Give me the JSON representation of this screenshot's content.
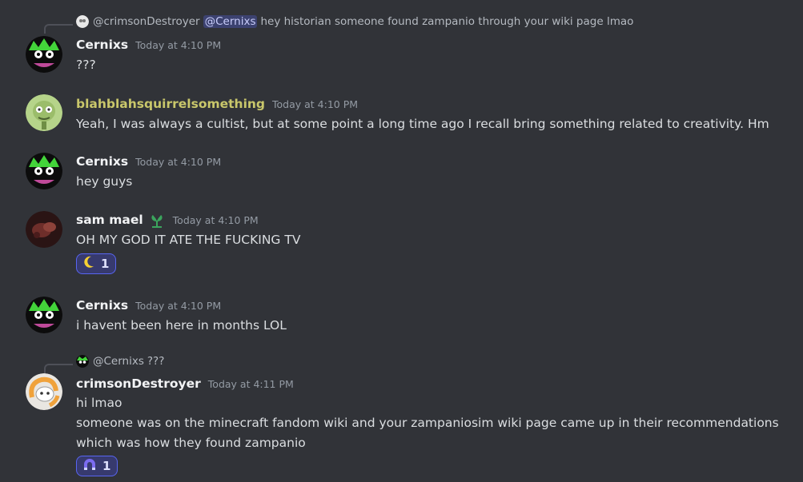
{
  "messages": [
    {
      "reply": {
        "author": "@crimsonDestroyer",
        "mention": "@Cernixs",
        "text": "hey historian someone found zampanio through your wiki page lmao"
      },
      "author": "Cernixs",
      "timestamp": "Today at 4:10 PM",
      "lines": [
        "???"
      ]
    },
    {
      "author": "blahblahsquirrelsomething",
      "timestamp": "Today at 4:10 PM",
      "lines": [
        "Yeah, I was always a cultist, but at some point a long time ago I recall bring something related to creativity. Hm"
      ]
    },
    {
      "author": "Cernixs",
      "timestamp": "Today at 4:10 PM",
      "lines": [
        "hey guys"
      ]
    },
    {
      "author": "sam mael",
      "badge": "leaf-badge-icon",
      "timestamp": "Today at 4:10 PM",
      "lines": [
        "OH MY GOD IT ATE THE FUCKING TV"
      ],
      "reaction": {
        "emoji": "moon-emoji",
        "count": "1"
      }
    },
    {
      "author": "Cernixs",
      "timestamp": "Today at 4:10 PM",
      "lines": [
        "i havent been here in months LOL"
      ]
    },
    {
      "reply": {
        "author": "@Cernixs",
        "text": "???"
      },
      "author": "crimsonDestroyer",
      "timestamp": "Today at 4:11 PM",
      "lines": [
        "hi lmao",
        "someone was on the minecraft fandom wiki and your zampaniosim wiki page came up in their recommendations",
        "which was how they found zampanio"
      ],
      "reaction": {
        "emoji": "magnet-emoji",
        "count": "1"
      }
    }
  ],
  "colors": {
    "background": "#313338",
    "username_highlight": "#c9c76b",
    "mention_bg": "#3c4270",
    "reaction_border": "#5865f2"
  }
}
